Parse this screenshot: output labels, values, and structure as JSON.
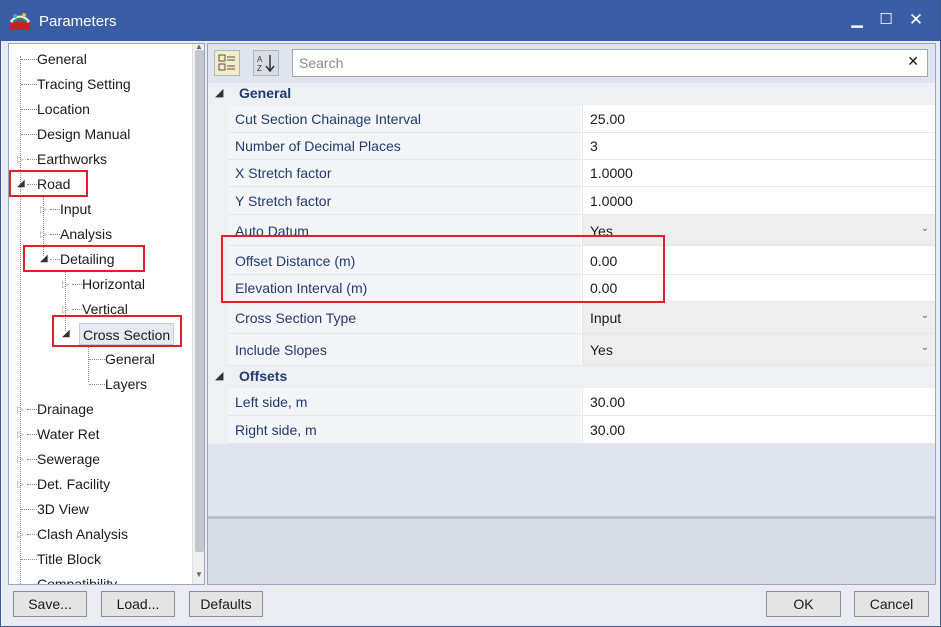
{
  "window": {
    "title": "Parameters",
    "minimize_glyph": "▁",
    "maximize_glyph": "☐",
    "close_glyph": "✕"
  },
  "tree": {
    "items": [
      {
        "label": "General"
      },
      {
        "label": "Tracing Setting"
      },
      {
        "label": "Location"
      },
      {
        "label": "Design Manual"
      },
      {
        "label": "Earthworks"
      },
      {
        "label": "Road"
      },
      {
        "label": "Input"
      },
      {
        "label": "Analysis"
      },
      {
        "label": "Detailing"
      },
      {
        "label": "Horizontal"
      },
      {
        "label": "Vertical"
      },
      {
        "label": "Cross Section"
      },
      {
        "label": "General"
      },
      {
        "label": "Layers"
      },
      {
        "label": "Drainage"
      },
      {
        "label": "Water Ret"
      },
      {
        "label": "Sewerage"
      },
      {
        "label": "Det. Facility"
      },
      {
        "label": "3D View"
      },
      {
        "label": "Clash Analysis"
      },
      {
        "label": "Title Block"
      },
      {
        "label": "Compatibility"
      }
    ],
    "selected": "Cross Section"
  },
  "toolbar": {
    "categorized_glyph": "⊞",
    "alpha_glyph": "A↓",
    "search_placeholder": "Search",
    "clear_glyph": "✕"
  },
  "grid": {
    "categories": [
      {
        "label": "General",
        "properties": [
          {
            "name": "Cut Section Chainage Interval",
            "value": "25.00"
          },
          {
            "name": "Number of Decimal Places",
            "value": "3"
          },
          {
            "name": "X Stretch factor",
            "value": "1.0000"
          },
          {
            "name": "Y Stretch factor",
            "value": "1.0000"
          },
          {
            "name": "Auto Datum",
            "value": "Yes",
            "dropdown": true
          },
          {
            "name": "Offset Distance (m)",
            "value": "0.00"
          },
          {
            "name": "Elevation Interval (m)",
            "value": "0.00"
          },
          {
            "name": "Cross Section Type",
            "value": "Input",
            "dropdown": true
          },
          {
            "name": "Include Slopes",
            "value": "Yes",
            "dropdown": true
          }
        ]
      },
      {
        "label": "Offsets",
        "properties": [
          {
            "name": "Left side, m",
            "value": "30.00"
          },
          {
            "name": "Right side, m",
            "value": "30.00"
          }
        ]
      }
    ]
  },
  "buttons": {
    "save": "Save...",
    "load": "Load...",
    "defaults": "Defaults",
    "ok": "OK",
    "cancel": "Cancel"
  },
  "colors": {
    "titlebar": "#3a5ea6",
    "highlight": "#e0212b",
    "property_text": "#1f3a6e"
  }
}
